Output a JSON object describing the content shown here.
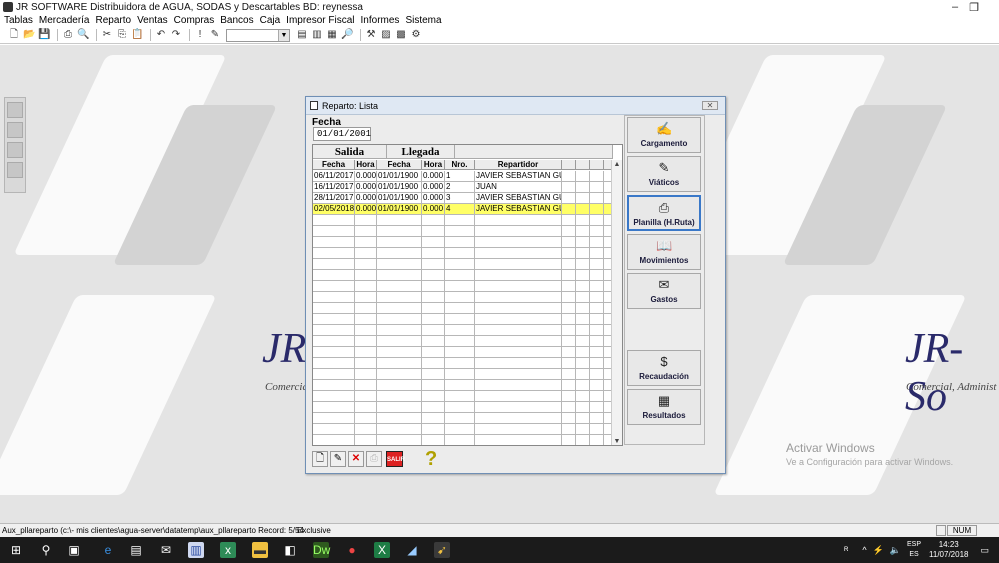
{
  "app": {
    "title": "JR SOFTWARE Distribuidora de AGUA, SODAS y Descartables BD: reynessa",
    "minimize": "–",
    "restore": "❐",
    "close": "✕"
  },
  "menu": [
    "Tablas",
    "Mercadería",
    "Reparto",
    "Ventas",
    "Compras",
    "Bancos",
    "Caja",
    "Impresor Fiscal",
    "Informes",
    "Sistema"
  ],
  "toolbar": {
    "icons": [
      "new-icon",
      "open-icon",
      "save-icon",
      "print-icon",
      "print-preview-icon",
      "cut-icon",
      "copy-icon",
      "paste-icon",
      "undo-icon",
      "redo-icon",
      "exclamation-icon",
      "edit-icon"
    ],
    "combo_value": "",
    "right_icons": [
      "grid-icon",
      "form-icon",
      "tile-icon",
      "preview-icon",
      "tools-icon",
      "report-icon",
      "calendar-icon",
      "settings-icon"
    ]
  },
  "workspace": {
    "brand_left": "JR",
    "brand_left_sub": "Comercia",
    "brand_right": "JR-So",
    "brand_right_sub": "Comercial, Administ",
    "activate_title": "Activar Windows",
    "activate_sub": "Ve a Configuración para activar Windows."
  },
  "dialog": {
    "title": "Reparto: Lista",
    "close_label": "✕",
    "fecha_label": "Fecha",
    "fecha_value": "01/01/2001",
    "group_salida": "Salida",
    "group_llegada": "Llegada",
    "columns": [
      "Fecha",
      "Hora",
      "Fecha",
      "Hora",
      "Nro.",
      "Repartidor"
    ],
    "rows": [
      [
        "06/11/2017",
        "0.000",
        "01/01/1900",
        "0.000",
        "1",
        "JAVIER SEBASTIAN GUE"
      ],
      [
        "16/11/2017",
        "0.000",
        "01/01/1900",
        "0.000",
        "2",
        "JUAN"
      ],
      [
        "28/11/2017",
        "0.000",
        "01/01/1900",
        "0.000",
        "3",
        "JAVIER SEBASTIAN GUE"
      ],
      [
        "02/05/2018",
        "0.000",
        "01/01/1900",
        "0.000",
        "4",
        "JAVIER SEBASTIAN GUE"
      ]
    ],
    "selected_row": 3,
    "side_buttons": [
      {
        "label": "Cargamento",
        "icon": "✍"
      },
      {
        "label": "Viáticos",
        "icon": "✎"
      },
      {
        "label": "Planilla (H.Ruta)",
        "icon": "⎙"
      },
      {
        "label": "Movimientos",
        "icon": "📖"
      },
      {
        "label": "Gastos",
        "icon": "✉"
      },
      {
        "label": "Recaudación",
        "icon": "$"
      },
      {
        "label": "Resultados",
        "icon": "▦"
      }
    ],
    "bottom": {
      "new": "🗋",
      "edit": "✎",
      "delete": "✕",
      "print": "⎙",
      "salir": "SALIR",
      "help": "?"
    }
  },
  "statusbar": {
    "path": "Aux_pllareparto (c:\\- mis clientes\\agua-server\\datatemp\\aux_pllareparto Record: 5/54",
    "mode": "Exclusive",
    "num": "NUM"
  },
  "taskbar": {
    "lang": "ESP",
    "lang_sub": "ES",
    "time": "14:23",
    "date": "11/07/2018"
  }
}
